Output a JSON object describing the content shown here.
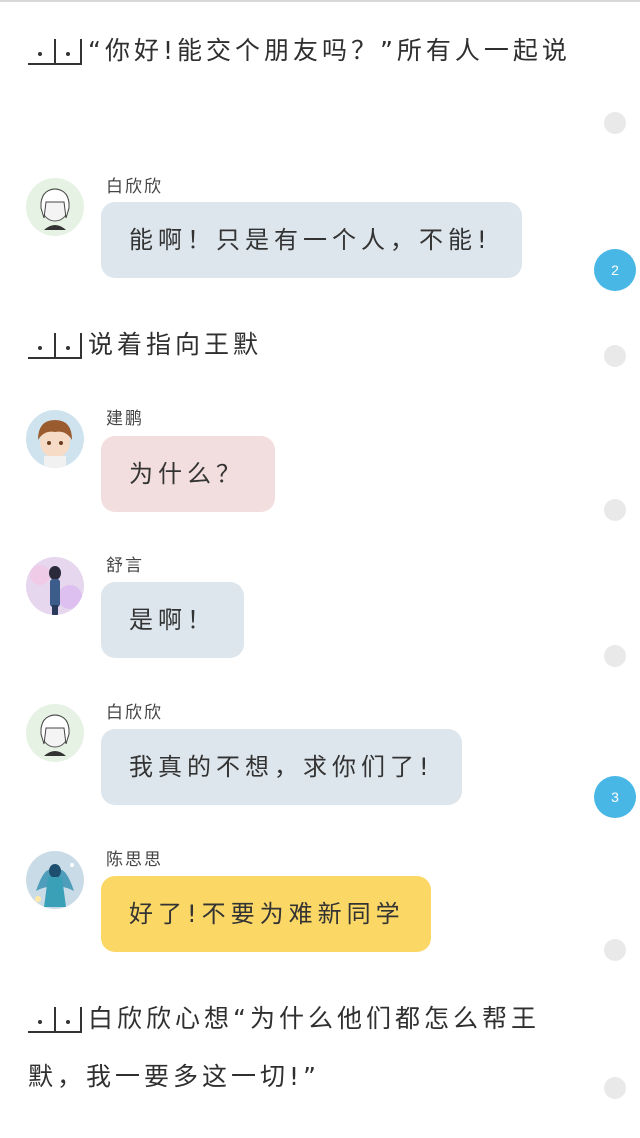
{
  "narration": [
    {
      "text": "“你好!能交个朋友吗？”所有人一起说"
    },
    {
      "text": "说着指向王默"
    },
    {
      "text": "白欣欣心想“为什么他们都怎么帮王默，我一要多这一切!”"
    }
  ],
  "messages": [
    {
      "speaker": "白欣欣",
      "text": "能啊！只是有一个人，不能!",
      "bubble_color": "#dde6ec",
      "avatar": "white-hair-girl-avatar"
    },
    {
      "speaker": "建鹏",
      "text": "为什么？",
      "bubble_color": "#f2dede",
      "avatar": "brown-hair-boy-avatar"
    },
    {
      "speaker": "舒言",
      "text": "是啊！",
      "bubble_color": "#dde6ec",
      "avatar": "purple-girl-avatar"
    },
    {
      "speaker": "白欣欣",
      "text": "我真的不想，求你们了!",
      "bubble_color": "#dde6ec",
      "avatar": "white-hair-girl-avatar"
    },
    {
      "speaker": "陈思思",
      "text": "好了!不要为难新同学",
      "bubble_color": "#fbd866",
      "avatar": "blue-fairy-avatar"
    }
  ],
  "badges": [
    {
      "count": "2"
    },
    {
      "count": "3"
    }
  ],
  "colors": {
    "accent_badge": "#48b7e6",
    "bubble_blue": "#dde6ec",
    "bubble_pink": "#f2dede",
    "bubble_yellow": "#fbd866"
  }
}
